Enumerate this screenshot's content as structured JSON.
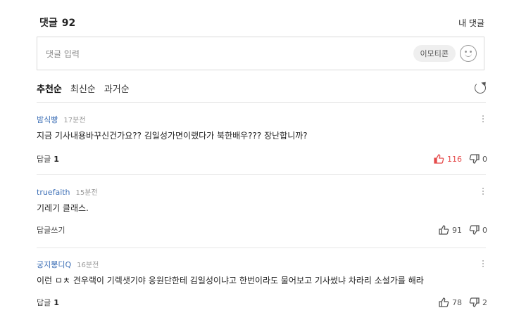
{
  "header": {
    "title": "댓글",
    "count": "92",
    "my_comments": "내 댓글"
  },
  "input": {
    "placeholder": "댓글 입력",
    "emoticon_label": "이모티콘"
  },
  "sort": {
    "tabs": [
      "추천순",
      "최신순",
      "과거순"
    ]
  },
  "comments": [
    {
      "author": "밤식빵",
      "time": "17분전",
      "text": "지금 기사내용바꾸신건가요?? 김일성가면이랬다가 북한배우??? 장난합니까?",
      "reply_label": "답글",
      "reply_count": "1",
      "likes": "116",
      "dislikes": "0"
    },
    {
      "author": "truefaith",
      "time": "15분전",
      "text": "기레기 클래스.",
      "reply_label": "답글쓰기",
      "reply_count": "",
      "likes": "91",
      "dislikes": "0"
    },
    {
      "author": "궁지뽕디Q",
      "time": "16분전",
      "text": "이런 ㅁㅊ 견우랙이 기렉샛기야 응원단한테 김일성이냐고 한번이라도 물어보고 기사썼냐  차라리 소설가를 해라",
      "reply_label": "답글",
      "reply_count": "1",
      "likes": "78",
      "dislikes": "2"
    }
  ],
  "colors": {
    "author": "#3d6fb6",
    "like_active": "#e54b4b",
    "divider": "#e6e6e6"
  },
  "icons": {
    "emoticon": "smiley-icon",
    "refresh": "refresh-icon",
    "more": "more-vertical-icon",
    "like": "thumbs-up-icon",
    "dislike": "thumbs-down-icon"
  }
}
